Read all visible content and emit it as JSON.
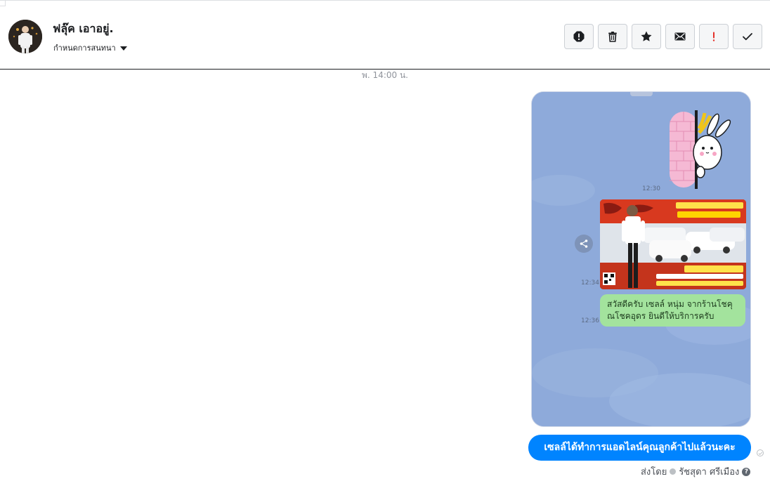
{
  "header": {
    "contact_name": "ฟลุ๊ค เอาอยู่.",
    "conversation_settings_label": "กำหนดการสนทนา",
    "toolbar": {
      "icons": [
        "alert-icon",
        "trash-icon",
        "star-icon",
        "envelope-icon",
        "exclamation-icon",
        "checkmark-icon"
      ],
      "exclamation_color": "#e4312a"
    }
  },
  "conversation": {
    "timestamp": "พ. 14:00 น.",
    "attachment": {
      "times": [
        "12:30",
        "12:34",
        "12:36"
      ],
      "line_message": "สวัสดีครับ เซลล์ หนุ่ม จากร้านโชคุณโชคอุดร ยินดีให้บริการครับ",
      "line_bubble_color": "#a3e39d",
      "background_color": "#8eaada"
    },
    "sent_message": "เซลล์ได้ทำการแอดไลน์คุณลูกค้าไปแล้วนะคะ",
    "sent_bubble_color": "#0084ff",
    "sent_by_label": "ส่งโดย",
    "sent_by_name": "รัชสุดา ศรีเมือง",
    "help_glyph": "?"
  }
}
